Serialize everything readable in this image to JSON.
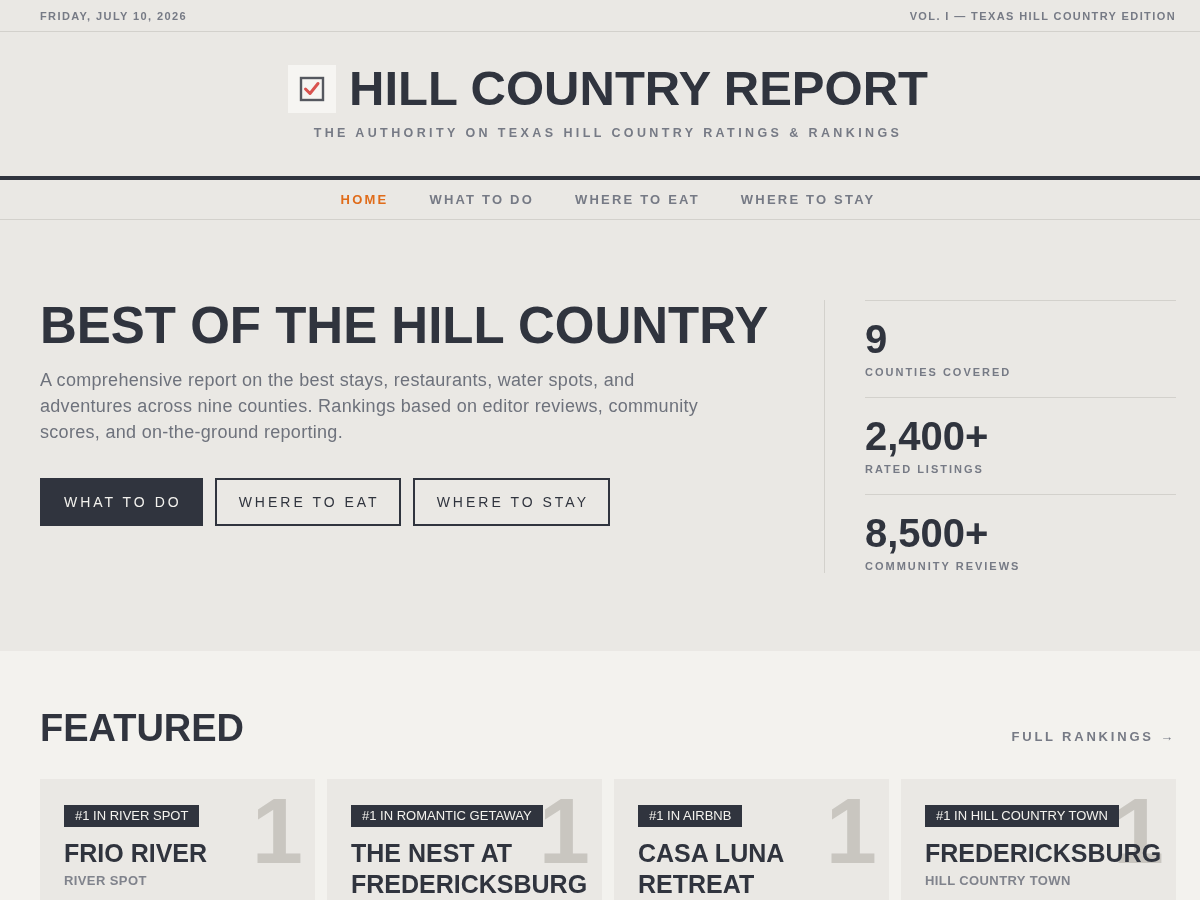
{
  "top_bar": {
    "date": "FRIDAY, JULY 10, 2026",
    "edition": "VOL. I — TEXAS HILL COUNTRY EDITION"
  },
  "masthead": {
    "title": "HILL COUNTRY REPORT",
    "tagline": "THE AUTHORITY ON TEXAS HILL COUNTRY RATINGS & RANKINGS"
  },
  "nav": [
    {
      "label": "HOME",
      "selected": true
    },
    {
      "label": "WHAT TO DO",
      "selected": false
    },
    {
      "label": "WHERE TO EAT",
      "selected": false
    },
    {
      "label": "WHERE TO STAY",
      "selected": false
    }
  ],
  "hero": {
    "heading": "BEST OF THE HILL COUNTRY",
    "intro": "A comprehensive report on the best stays, restaurants, water spots, and adventures across nine counties. Rankings based on editor reviews, community scores, and on-the-ground reporting.",
    "buttons": [
      {
        "label": "WHAT TO DO",
        "kind": "primary"
      },
      {
        "label": "WHERE TO EAT",
        "kind": "outline"
      },
      {
        "label": "WHERE TO STAY",
        "kind": "outline"
      }
    ],
    "stats": [
      {
        "value": "9",
        "label": "COUNTIES COVERED"
      },
      {
        "value": "2,400+",
        "label": "RATED LISTINGS"
      },
      {
        "value": "8,500+",
        "label": "COMMUNITY REVIEWS"
      }
    ]
  },
  "featured": {
    "heading": "FEATURED",
    "link": "FULL RANKINGS →",
    "cards": [
      {
        "badge": "#1 IN RIVER SPOT",
        "rank_numeral": "1",
        "name": "FRIO RIVER",
        "category": "RIVER SPOT"
      },
      {
        "badge": "#1 IN ROMANTIC GETAWAY",
        "rank_numeral": "1",
        "name": "THE NEST AT FREDERICKSBURG"
      },
      {
        "badge": "#1 IN AIRBNB",
        "rank_numeral": "1",
        "name": "CASA LUNA RETREAT"
      },
      {
        "badge": "#1 IN HILL COUNTRY TOWN",
        "rank_numeral": "1",
        "name": "FREDERICKSBURG",
        "category": "HILL COUNTRY TOWN"
      }
    ]
  }
}
